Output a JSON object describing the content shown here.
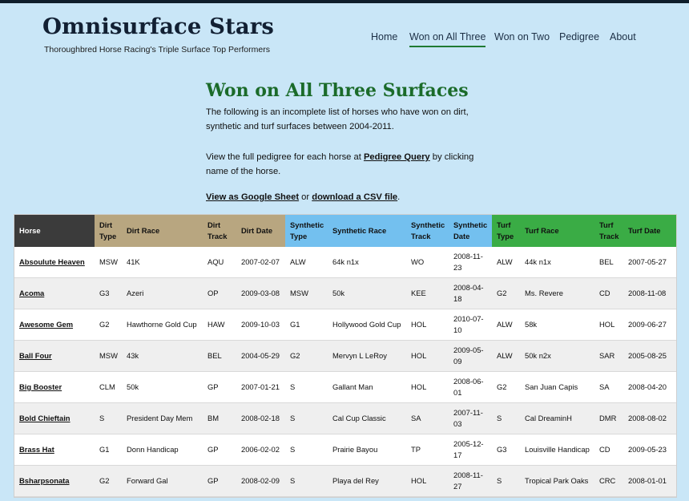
{
  "site": {
    "title": "Omnisurface Stars",
    "subtitle": "Thoroughbred Horse Racing's Triple Surface Top Performers"
  },
  "nav": [
    {
      "label": "Home",
      "active": false
    },
    {
      "label": "Won on All Three",
      "active": true
    },
    {
      "label": "Won on Two",
      "active": false
    },
    {
      "label": "Pedigree",
      "active": false
    },
    {
      "label": "About",
      "active": false
    }
  ],
  "main": {
    "heading": "Won on All Three Surfaces",
    "intro": "The following is an incomplete list of horses who have won on dirt, synthetic and turf surfaces between 2004-2011.",
    "pedigree_before": "View the full pedigree for each horse at ",
    "pedigree_link": "Pedigree Query",
    "pedigree_after": " by clicking name of the horse.",
    "sheet_link": "View as Google Sheet",
    "or_text": " or ",
    "csv_link": "download a CSV file",
    "period": "."
  },
  "colors": {
    "background": "#c9e6f7",
    "heading_green": "#1b6b2a",
    "horse_header": "#3b3b3b",
    "dirt_header": "#b8a680",
    "synthetic_header": "#73c0ef",
    "turf_header": "#3aac45"
  },
  "table": {
    "headers": [
      "Horse",
      "Dirt Type",
      "Dirt Race",
      "Dirt Track",
      "Dirt Date",
      "Synthetic Type",
      "Synthetic Race",
      "Synthetic Track",
      "Synthetic Date",
      "Turf Type",
      "Turf Race",
      "Turf Track",
      "Turf Date"
    ],
    "rows": [
      [
        "Absoulute Heaven",
        "MSW",
        "41K",
        "AQU",
        "2007-02-07",
        "ALW",
        "64k n1x",
        "WO",
        "2008-11-23",
        "ALW",
        "44k n1x",
        "BEL",
        "2007-05-27"
      ],
      [
        "Acoma",
        "G3",
        "Azeri",
        "OP",
        "2009-03-08",
        "MSW",
        "50k",
        "KEE",
        "2008-04-18",
        "G2",
        "Ms. Revere",
        "CD",
        "2008-11-08"
      ],
      [
        "Awesome Gem",
        "G2",
        "Hawthorne Gold Cup",
        "HAW",
        "2009-10-03",
        "G1",
        "Hollywood Gold Cup",
        "HOL",
        "2010-07-10",
        "ALW",
        "58k",
        "HOL",
        "2009-06-27"
      ],
      [
        "Ball Four",
        "MSW",
        "43k",
        "BEL",
        "2004-05-29",
        "G2",
        "Mervyn L LeRoy",
        "HOL",
        "2009-05-09",
        "ALW",
        "50k n2x",
        "SAR",
        "2005-08-25"
      ],
      [
        "Big Booster",
        "CLM",
        "50k",
        "GP",
        "2007-01-21",
        "S",
        "Gallant Man",
        "HOL",
        "2008-06-01",
        "G2",
        "San Juan Capis",
        "SA",
        "2008-04-20"
      ],
      [
        "Bold Chieftain",
        "S",
        "President Day Mem",
        "BM",
        "2008-02-18",
        "S",
        "Cal Cup Classic",
        "SA",
        "2007-11-03",
        "S",
        "Cal DreaminH",
        "DMR",
        "2008-08-02"
      ],
      [
        "Brass Hat",
        "G1",
        "Donn Handicap",
        "GP",
        "2006-02-02",
        "S",
        "Prairie Bayou",
        "TP",
        "2005-12-17",
        "G3",
        "Louisville Handicap",
        "CD",
        "2009-05-23"
      ],
      [
        "Bsharpsonata",
        "G2",
        "Forward Gal",
        "GP",
        "2008-02-09",
        "S",
        "Playa del Rey",
        "HOL",
        "2008-11-27",
        "S",
        "Tropical Park Oaks",
        "CRC",
        "2008-01-01"
      ]
    ]
  }
}
